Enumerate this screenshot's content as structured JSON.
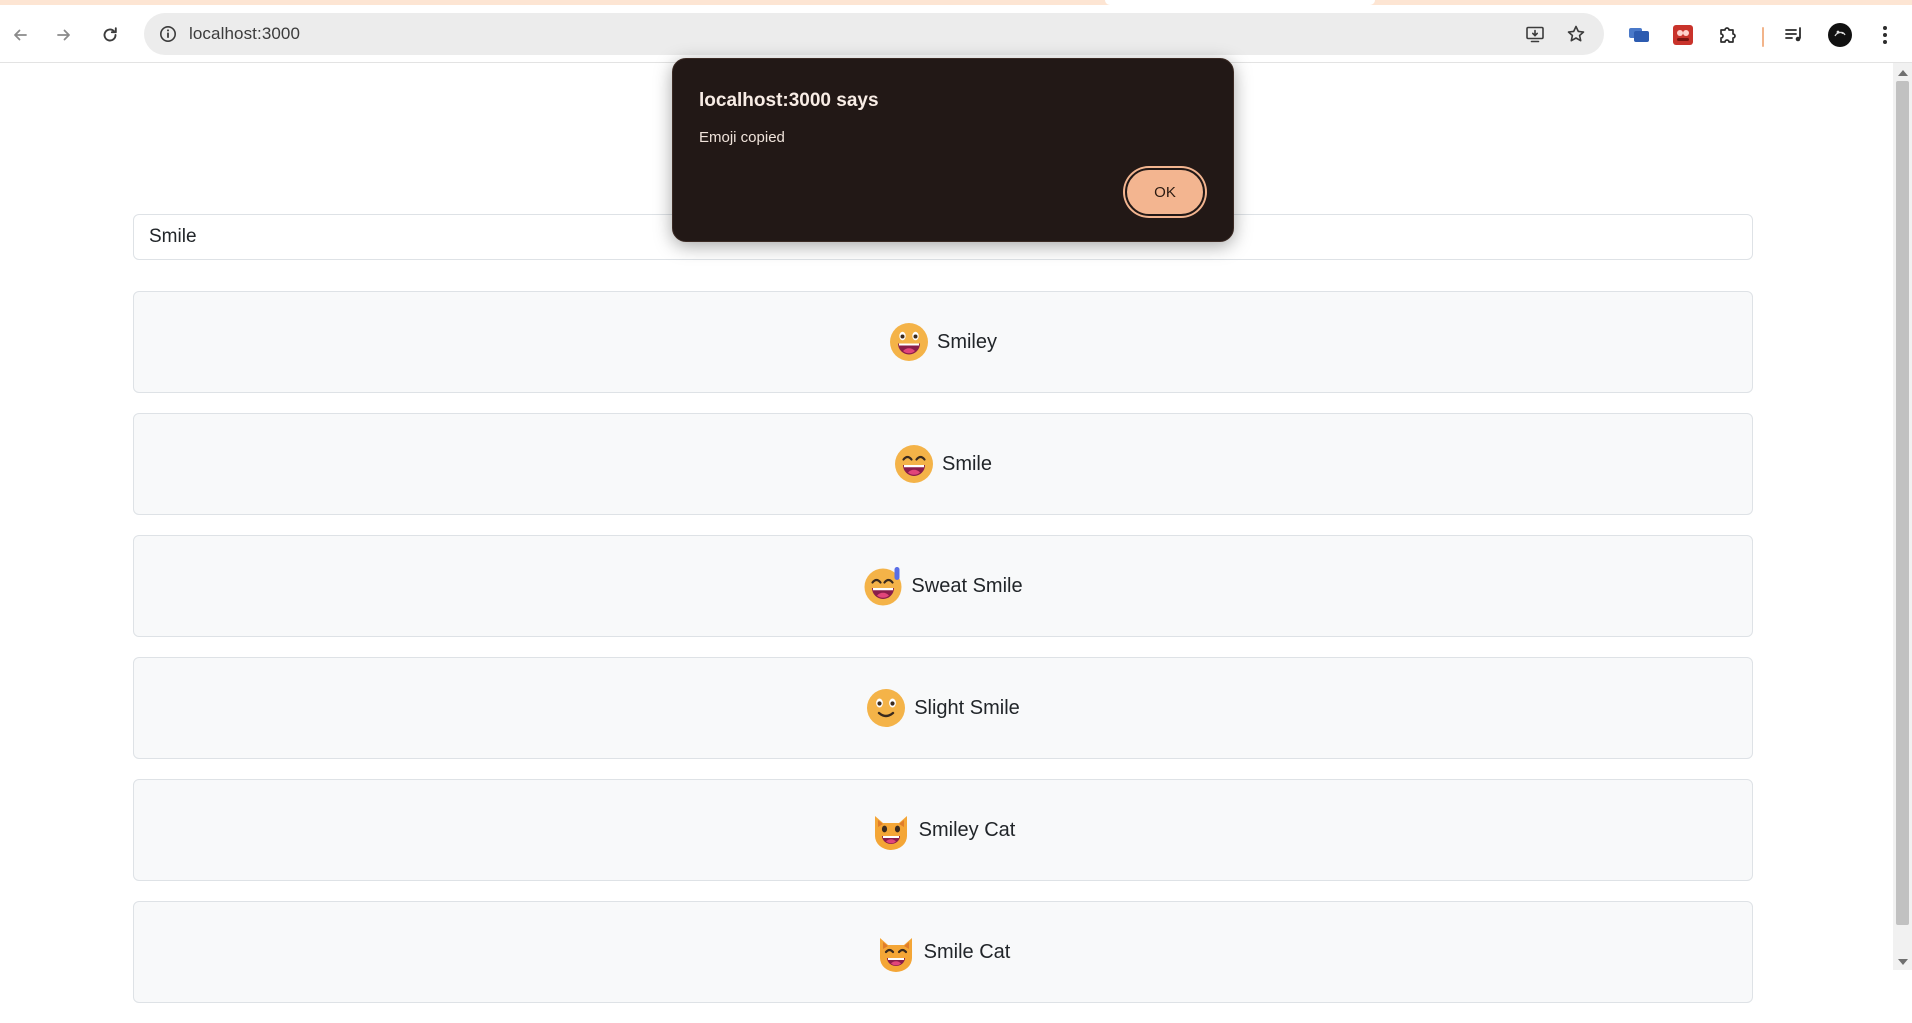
{
  "browser": {
    "url": "localhost:3000",
    "icons": {
      "back": "back-arrow-icon",
      "forward": "forward-arrow-icon",
      "reload": "reload-icon",
      "site_info": "info-icon",
      "install": "install-app-icon",
      "bookmark": "star-icon",
      "extensions": "puzzle-icon",
      "media": "media-control-icon",
      "menu": "kebab-menu-icon"
    },
    "colors": {
      "tabstrip": "#fde5d3",
      "omnibox": "#ececec"
    }
  },
  "page": {
    "search": {
      "value": "Smile"
    },
    "results": [
      {
        "label": "Smiley",
        "icon": "grinning-face-big-eyes-icon"
      },
      {
        "label": "Smile",
        "icon": "grinning-face-smiling-eyes-icon"
      },
      {
        "label": "Sweat Smile",
        "icon": "grinning-face-sweat-icon"
      },
      {
        "label": "Slight Smile",
        "icon": "slightly-smiling-face-icon"
      },
      {
        "label": "Smiley Cat",
        "icon": "grinning-cat-icon"
      },
      {
        "label": "Smile Cat",
        "icon": "grinning-cat-smiling-eyes-icon"
      }
    ]
  },
  "alert": {
    "title": "localhost:3000 says",
    "message": "Emoji copied",
    "ok_label": "OK",
    "colors": {
      "background": "#221816",
      "button": "#f3b590"
    }
  }
}
